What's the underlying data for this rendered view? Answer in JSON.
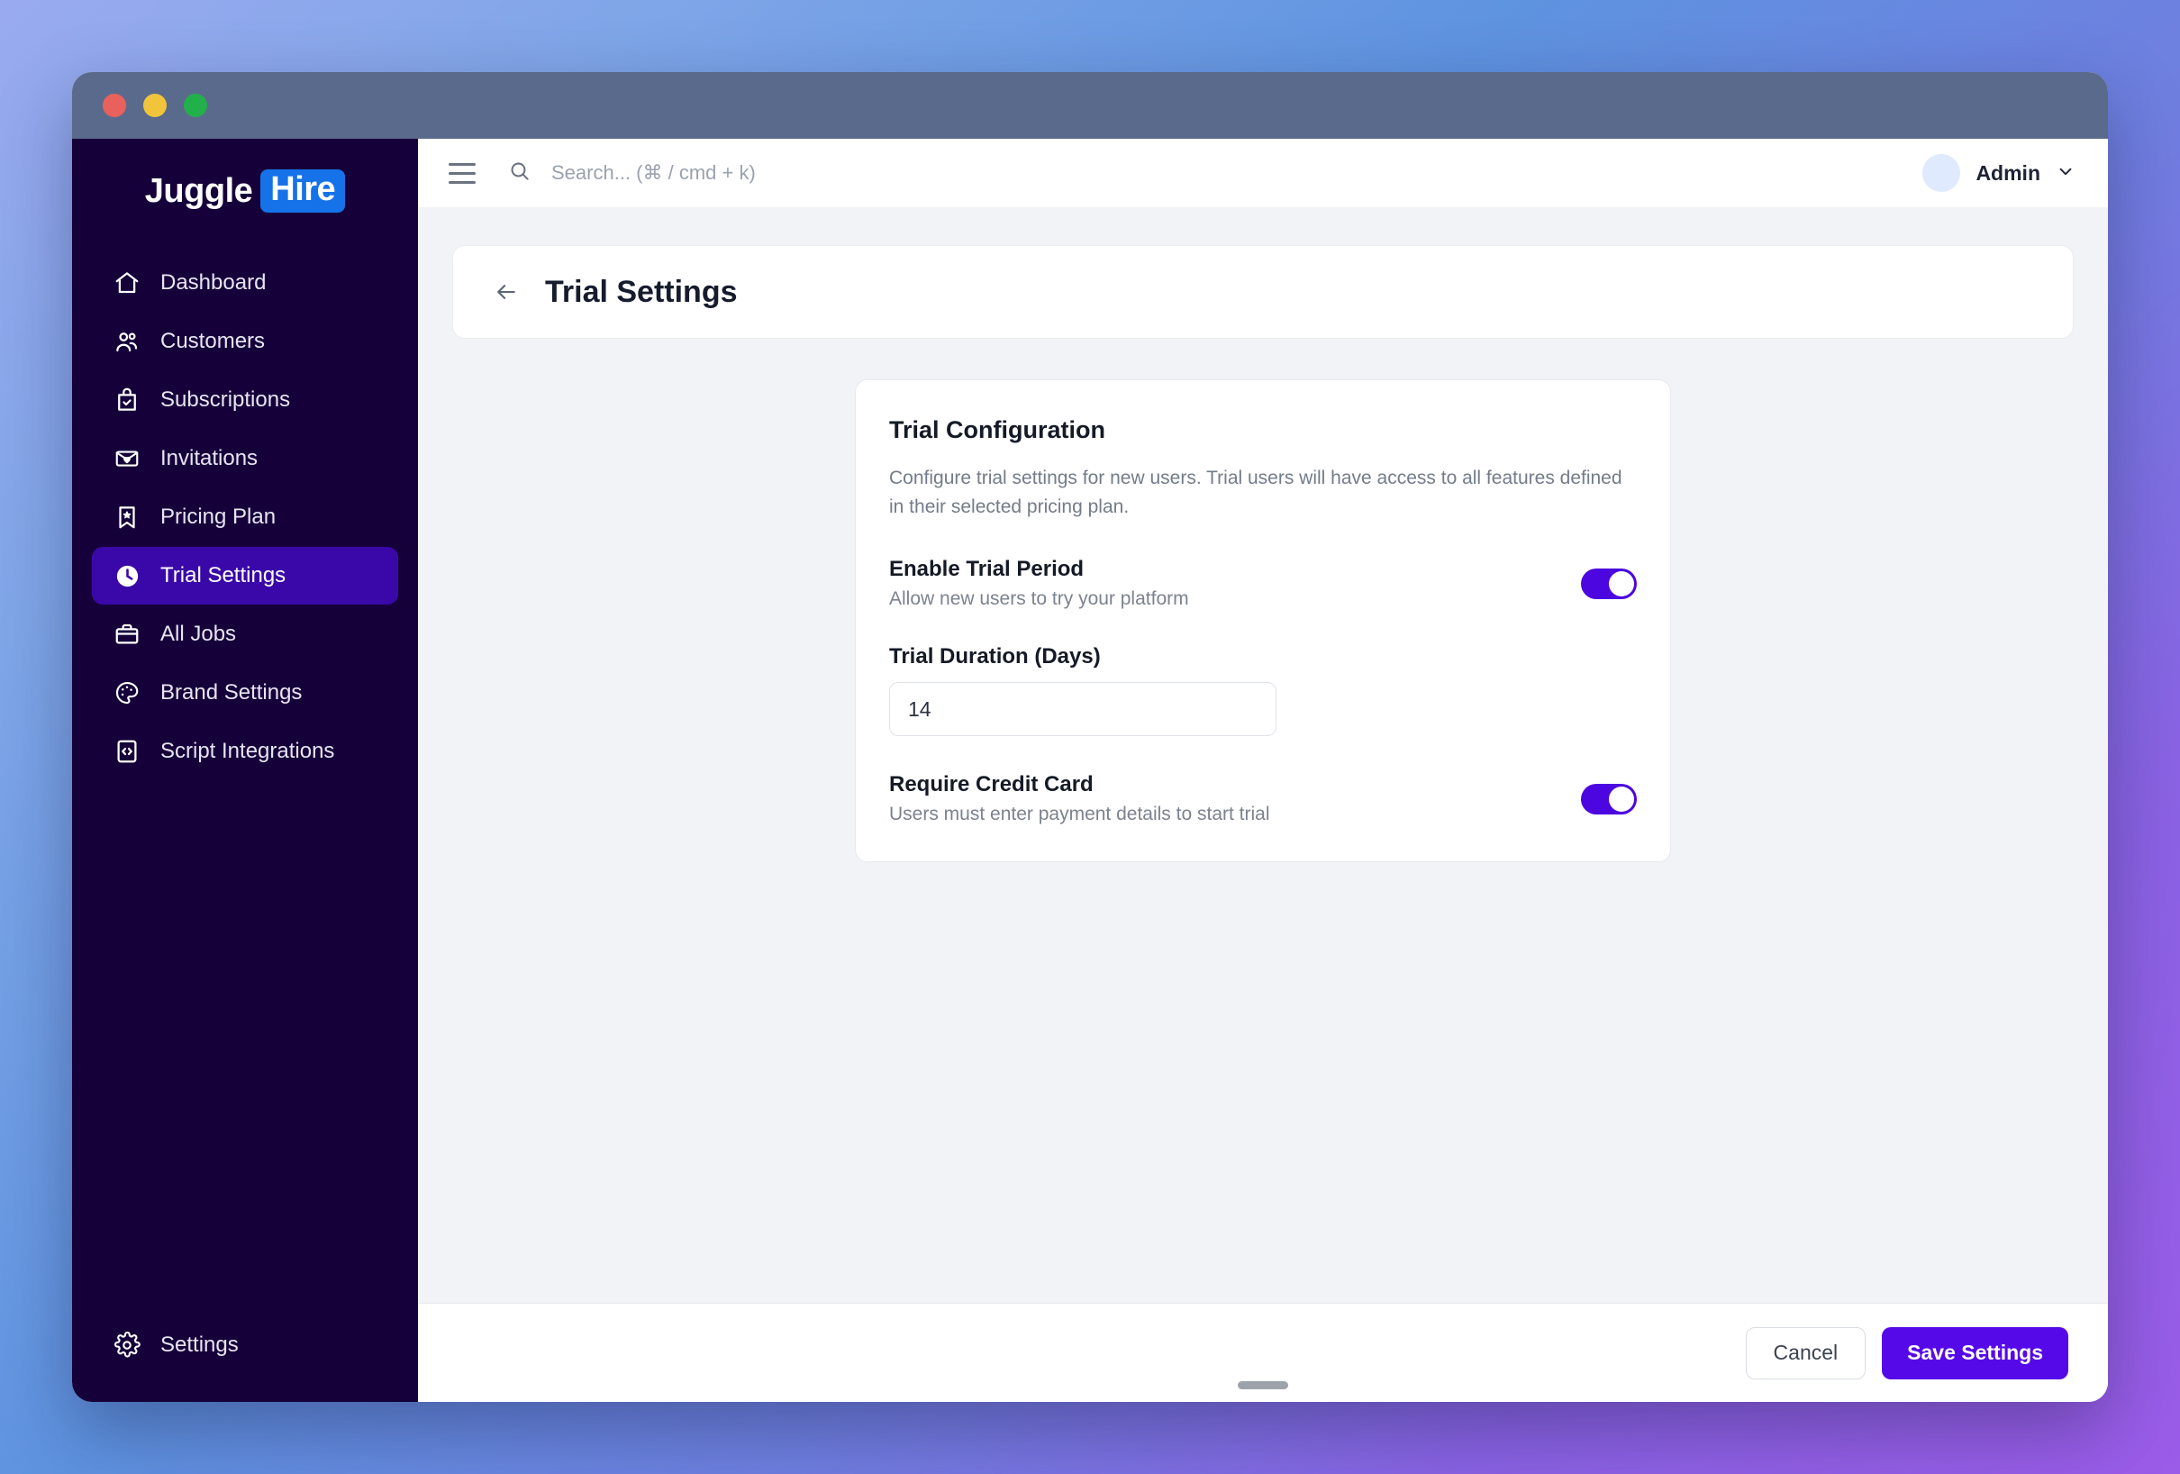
{
  "window": {
    "traffic_lights": [
      "close",
      "minimize",
      "zoom"
    ]
  },
  "sidebar": {
    "logo": {
      "primary": "Juggle",
      "badge": "Hire",
      "badge_color": "#1572e8"
    },
    "active_color": "#3a08a8",
    "background": "#15003a",
    "items": [
      {
        "label": "Dashboard",
        "icon": "home-icon",
        "active": false
      },
      {
        "label": "Customers",
        "icon": "users-icon",
        "active": false
      },
      {
        "label": "Subscriptions",
        "icon": "bag-check-icon",
        "active": false
      },
      {
        "label": "Invitations",
        "icon": "mail-heart-icon",
        "active": false
      },
      {
        "label": "Pricing Plan",
        "icon": "bookmark-star-icon",
        "active": false
      },
      {
        "label": "Trial Settings",
        "icon": "clock-icon",
        "active": true
      },
      {
        "label": "All Jobs",
        "icon": "briefcase-icon",
        "active": false
      },
      {
        "label": "Brand Settings",
        "icon": "palette-icon",
        "active": false
      },
      {
        "label": "Script Integrations",
        "icon": "code-icon",
        "active": false
      }
    ],
    "bottom_item": {
      "label": "Settings",
      "icon": "gear-icon"
    }
  },
  "topbar": {
    "menu_icon": "hamburger-icon",
    "search": {
      "icon": "search-icon",
      "placeholder": "Search...  (⌘ / cmd + k)"
    },
    "user": {
      "name": "Admin",
      "avatar_color": "#dfeaff",
      "chevron": "chevron-down-icon"
    }
  },
  "page": {
    "back_icon": "arrow-left-icon",
    "title": "Trial Settings"
  },
  "card": {
    "title": "Trial Configuration",
    "description": "Configure trial settings for new users. Trial users will have access to all features defined in their selected pricing plan.",
    "settings": [
      {
        "label": "Enable Trial Period",
        "sublabel": "Allow new users to try your platform",
        "toggle_on": true
      },
      {
        "label": "Require Credit Card",
        "sublabel": "Users must enter payment details to start trial",
        "toggle_on": true
      }
    ],
    "duration_field": {
      "label": "Trial Duration (Days)",
      "value": "14"
    },
    "toggle_on_color": "#4c06e0"
  },
  "footer": {
    "cancel_label": "Cancel",
    "save_label": "Save Settings",
    "save_color": "#5609e8"
  }
}
